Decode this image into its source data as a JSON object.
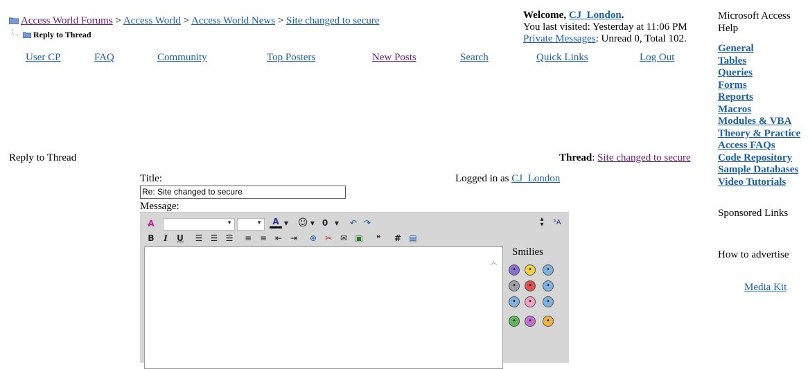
{
  "breadcrumb": {
    "items": [
      "Access World Forums",
      "Access World",
      "Access World News",
      "Site changed to secure"
    ],
    "separator": ">",
    "current": "Reply to Thread"
  },
  "welcome": {
    "prefix": "Welcome,",
    "username": "CJ_London",
    "suffix": ".",
    "last_visited": "You last visited: Yesterday at 11:06 PM",
    "pm_link": "Private Messages",
    "pm_status": ": Unread 0, Total 102."
  },
  "nav": [
    "User CP",
    "FAQ",
    "Community",
    "Top Posters",
    "New Posts",
    "Search",
    "Quick Links",
    "Log Out"
  ],
  "sidebar": {
    "heading": "Microsoft Access Help",
    "links": [
      "General",
      "Tables",
      "Queries",
      "Forms",
      "Reports",
      "Macros",
      "Modules & VBA",
      "Theory & Practice",
      "Access FAQs",
      "Code Repository",
      "Sample Databases",
      "Video Tutorials"
    ],
    "sponsored": "Sponsored Links",
    "advertise": "How to advertise",
    "media_kit": "Media Kit"
  },
  "reply": {
    "heading": "Reply to Thread",
    "thread_label": "Thread",
    "thread_link": "Site changed to secure",
    "title_label": "Title:",
    "title_value": "Re: Site changed to secure",
    "logged_in_prefix": "Logged in as",
    "logged_in_user": "CJ_London",
    "message_label": "Message:"
  },
  "editor": {
    "font_name": "",
    "font_size": "",
    "smilies_label": "Smilies",
    "smilies": [
      {
        "icon": "frown-purple",
        "color": "#8a6fd1"
      },
      {
        "icon": "smile-yellow",
        "color": "#f2d23c"
      },
      {
        "icon": "confused-blue",
        "color": "#7fb2e0"
      },
      {
        "icon": "eek-grey",
        "color": "#9aa0a6"
      },
      {
        "icon": "mad-red",
        "color": "#e05050"
      },
      {
        "icon": "wink-blue",
        "color": "#7fb2e0"
      },
      {
        "icon": "cool-blue",
        "color": "#7fb2e0"
      },
      {
        "icon": "tongue-pink",
        "color": "#f0a0c0"
      },
      {
        "icon": "smile-blue",
        "color": "#7fb2e0"
      },
      {
        "icon": "grin-green",
        "color": "#5cb85c"
      },
      {
        "icon": "redface-purple",
        "color": "#c070d0"
      },
      {
        "icon": "rolleyes-yellow",
        "color": "#f2b23c"
      }
    ]
  },
  "colors": {
    "link": "#1a5fa8",
    "visited": "#6a1b7a",
    "editor_bg": "#d6d6d6"
  }
}
